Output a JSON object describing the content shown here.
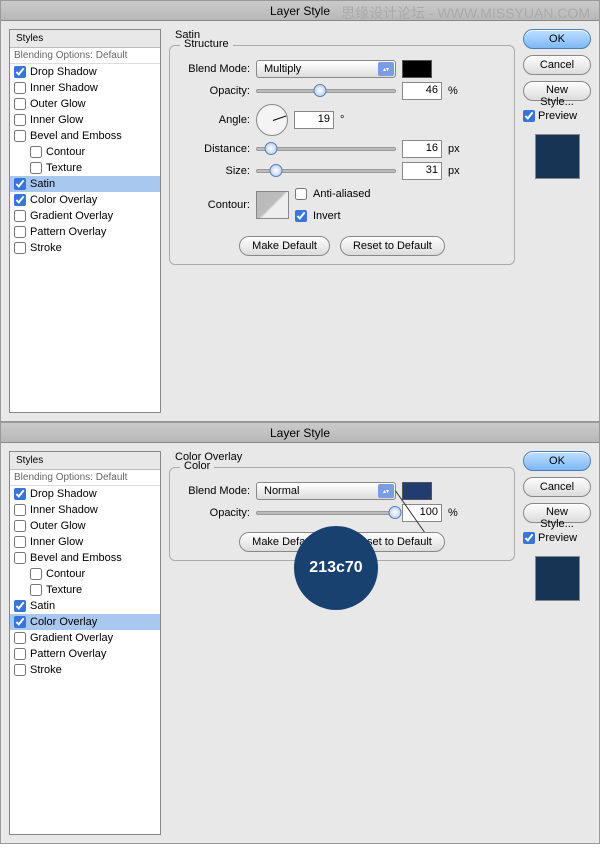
{
  "watermark_text": "思缘设计论坛 - WWW.MISSYUAN.COM",
  "dialog_title": "Layer Style",
  "styles_panel": {
    "header": "Styles",
    "blend_header": "Blending Options: Default",
    "items": [
      {
        "label": "Drop Shadow",
        "checked": true
      },
      {
        "label": "Inner Shadow",
        "checked": false
      },
      {
        "label": "Outer Glow",
        "checked": false
      },
      {
        "label": "Inner Glow",
        "checked": false
      },
      {
        "label": "Bevel and Emboss",
        "checked": false
      },
      {
        "label": "Contour",
        "checked": false,
        "indent": true
      },
      {
        "label": "Texture",
        "checked": false,
        "indent": true
      },
      {
        "label": "Satin",
        "checked": true
      },
      {
        "label": "Color Overlay",
        "checked": true
      },
      {
        "label": "Gradient Overlay",
        "checked": false
      },
      {
        "label": "Pattern Overlay",
        "checked": false
      },
      {
        "label": "Stroke",
        "checked": false
      }
    ]
  },
  "satin": {
    "title": "Satin",
    "structure": "Structure",
    "blend_mode_label": "Blend Mode:",
    "blend_mode_value": "Multiply",
    "opacity_label": "Opacity:",
    "opacity_value": "46",
    "opacity_unit": "%",
    "angle_label": "Angle:",
    "angle_value": "19",
    "angle_unit": "°",
    "distance_label": "Distance:",
    "distance_value": "16",
    "distance_unit": "px",
    "size_label": "Size:",
    "size_value": "31",
    "size_unit": "px",
    "contour": "Contour:",
    "antialiased": "Anti-aliased",
    "invert": "Invert",
    "make_default": "Make Default",
    "reset_default": "Reset to Default"
  },
  "color_overlay": {
    "title": "Color Overlay",
    "color": "Color",
    "blend_mode_label": "Blend Mode:",
    "blend_mode_value": "Normal",
    "opacity_label": "Opacity:",
    "opacity_value": "100",
    "opacity_unit": "%",
    "make_default": "Make Default",
    "reset_default": "Reset to Default"
  },
  "buttons": {
    "ok": "OK",
    "cancel": "Cancel",
    "new_style": "New Style...",
    "preview": "Preview"
  },
  "callout_text": "213c70"
}
